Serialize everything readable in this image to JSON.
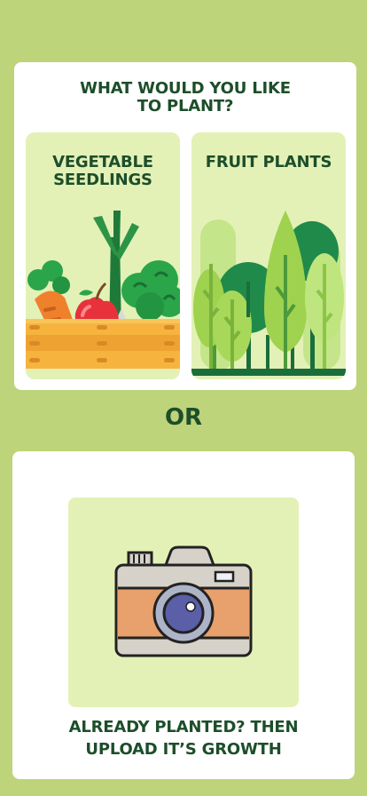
{
  "plant_card": {
    "question": "WHAT WOULD YOU LIKE\nTO PLANT?",
    "options": [
      {
        "label": "VEGETABLE\nSEEDLINGS",
        "icon": "vegetable-crate-icon"
      },
      {
        "label": "FRUIT PLANTS",
        "icon": "fruit-trees-icon"
      }
    ]
  },
  "divider": {
    "text": "OR"
  },
  "upload_card": {
    "icon": "camera-icon",
    "text": "ALREADY PLANTED? THEN\nUPLOAD IT’S GROWTH"
  },
  "colors": {
    "background": "#bed47a",
    "card": "#ffffff",
    "tile": "#e3f1b7",
    "text": "#1d4e2a"
  }
}
